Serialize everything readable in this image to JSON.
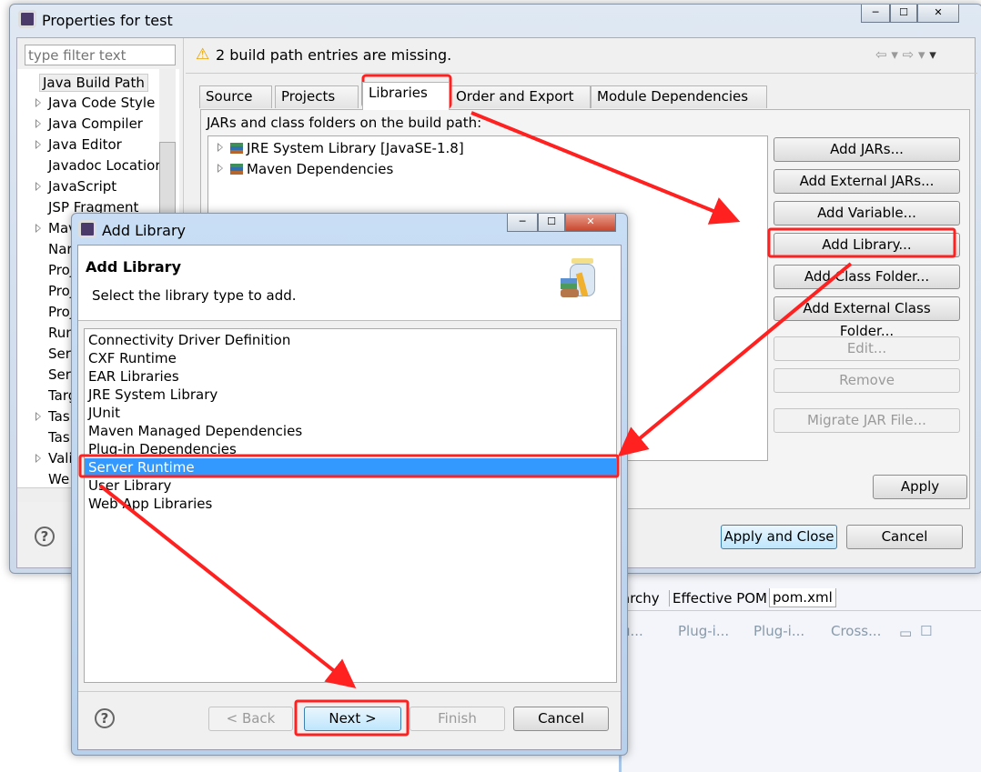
{
  "background": {
    "tabs": [
      "archy",
      "Effective POM",
      "pom.xml"
    ],
    "views": [
      "u...",
      "Plug-i...",
      "Plug-i...",
      "Cross..."
    ]
  },
  "properties": {
    "title": "Properties for test",
    "filter_placeholder": "type filter text",
    "tree": [
      {
        "label": "Java Build Path",
        "expand": false,
        "selected": true
      },
      {
        "label": "Java Code Style",
        "expand": true
      },
      {
        "label": "Java Compiler",
        "expand": true
      },
      {
        "label": "Java Editor",
        "expand": true
      },
      {
        "label": "Javadoc Locatior",
        "expand": false
      },
      {
        "label": "JavaScript",
        "expand": true
      },
      {
        "label": "JSP Fragment",
        "expand": false
      },
      {
        "label": "Mav",
        "expand": true
      },
      {
        "label": "Nar",
        "expand": false
      },
      {
        "label": "Proj",
        "expand": false
      },
      {
        "label": "Proj",
        "expand": false
      },
      {
        "label": "Proj",
        "expand": false
      },
      {
        "label": "Run",
        "expand": false
      },
      {
        "label": "Serv",
        "expand": false
      },
      {
        "label": "Serv",
        "expand": false
      },
      {
        "label": "Targ",
        "expand": false
      },
      {
        "label": "Task",
        "expand": true
      },
      {
        "label": "Task",
        "expand": false
      },
      {
        "label": "Vali",
        "expand": true
      },
      {
        "label": "We",
        "expand": false
      }
    ],
    "warning": "2 build path entries are missing.",
    "tabs": [
      {
        "label": "Source"
      },
      {
        "label": "Projects"
      },
      {
        "label": "Libraries",
        "active": true
      },
      {
        "label": "Order and Export"
      },
      {
        "label": "Module Dependencies"
      }
    ],
    "panel_label": "JARs and class folders on the build path:",
    "entries": [
      "JRE System Library [JavaSE-1.8]",
      "Maven Dependencies"
    ],
    "buttons": [
      {
        "label": "Add JARs...",
        "enabled": true
      },
      {
        "label": "Add External JARs...",
        "enabled": true
      },
      {
        "label": "Add Variable...",
        "enabled": true
      },
      {
        "label": "Add Library...",
        "enabled": true
      },
      {
        "label": "Add Class Folder...",
        "enabled": true
      },
      {
        "label": "Add External Class Folder...",
        "enabled": true
      },
      {
        "label": "Edit...",
        "enabled": false
      },
      {
        "label": "Remove",
        "enabled": false
      },
      {
        "label": "Migrate JAR File...",
        "enabled": false
      }
    ],
    "apply": "Apply",
    "apply_close": "Apply and Close",
    "cancel": "Cancel"
  },
  "add_library": {
    "title": "Add Library",
    "heading": "Add Library",
    "description": "Select the library type to add.",
    "items": [
      "Connectivity Driver Definition",
      "CXF Runtime",
      "EAR Libraries",
      "JRE System Library",
      "JUnit",
      "Maven Managed Dependencies",
      "Plug-in Dependencies",
      "Server Runtime",
      "User Library",
      "Web App Libraries"
    ],
    "selected": "Server Runtime",
    "back": "< Back",
    "next": "Next >",
    "finish": "Finish",
    "cancel": "Cancel"
  },
  "colors": {
    "annotation": "#ff2020",
    "selection": "#3399ff"
  }
}
